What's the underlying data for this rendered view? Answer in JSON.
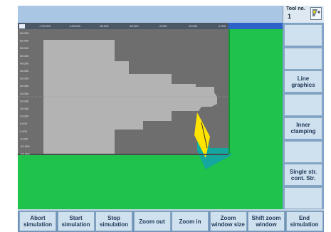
{
  "tool": {
    "label": "Tool no.",
    "number": "1",
    "icon": "tool-preview-icon"
  },
  "vertical_softkeys": [
    {
      "label": ""
    },
    {
      "label": ""
    },
    {
      "label": "Line\ngraphics"
    },
    {
      "label": ""
    },
    {
      "label": "Inner\nclamping"
    },
    {
      "label": ""
    },
    {
      "label": "Single str.\ncont. Str."
    },
    {
      "label": ""
    }
  ],
  "horizontal_softkeys": [
    {
      "label": "Abort\nsimulation"
    },
    {
      "label": "Start\nsimulation"
    },
    {
      "label": "Stop\nsimulation"
    },
    {
      "label": "Zoom out"
    },
    {
      "label": "Zoom in"
    },
    {
      "label": "Zoom\nwindow size"
    },
    {
      "label": "Shift zoom\nwindow"
    },
    {
      "label": "End\nsimulation"
    }
  ],
  "graphic": {
    "x_ticks": [
      "-170.000",
      "-145.000",
      "-95.000",
      "-45.000",
      "-5.000",
      "25.000",
      "0.000"
    ],
    "y_ticks": [
      "65.000",
      "60.000",
      "55.000",
      "50.000",
      "45.000",
      "40.000",
      "35.000",
      "30.000",
      "25.000",
      "20.000",
      "15.000",
      "10.000",
      "5.000",
      "0.000",
      "-5.000",
      "-10.000",
      "-15.000"
    ],
    "colors": {
      "workpiece": "#b3b3b3",
      "chuck": "#6e6e6e",
      "machine": "#1fc24a",
      "tool": "#ffe400",
      "holder": "#13a7a0"
    }
  }
}
